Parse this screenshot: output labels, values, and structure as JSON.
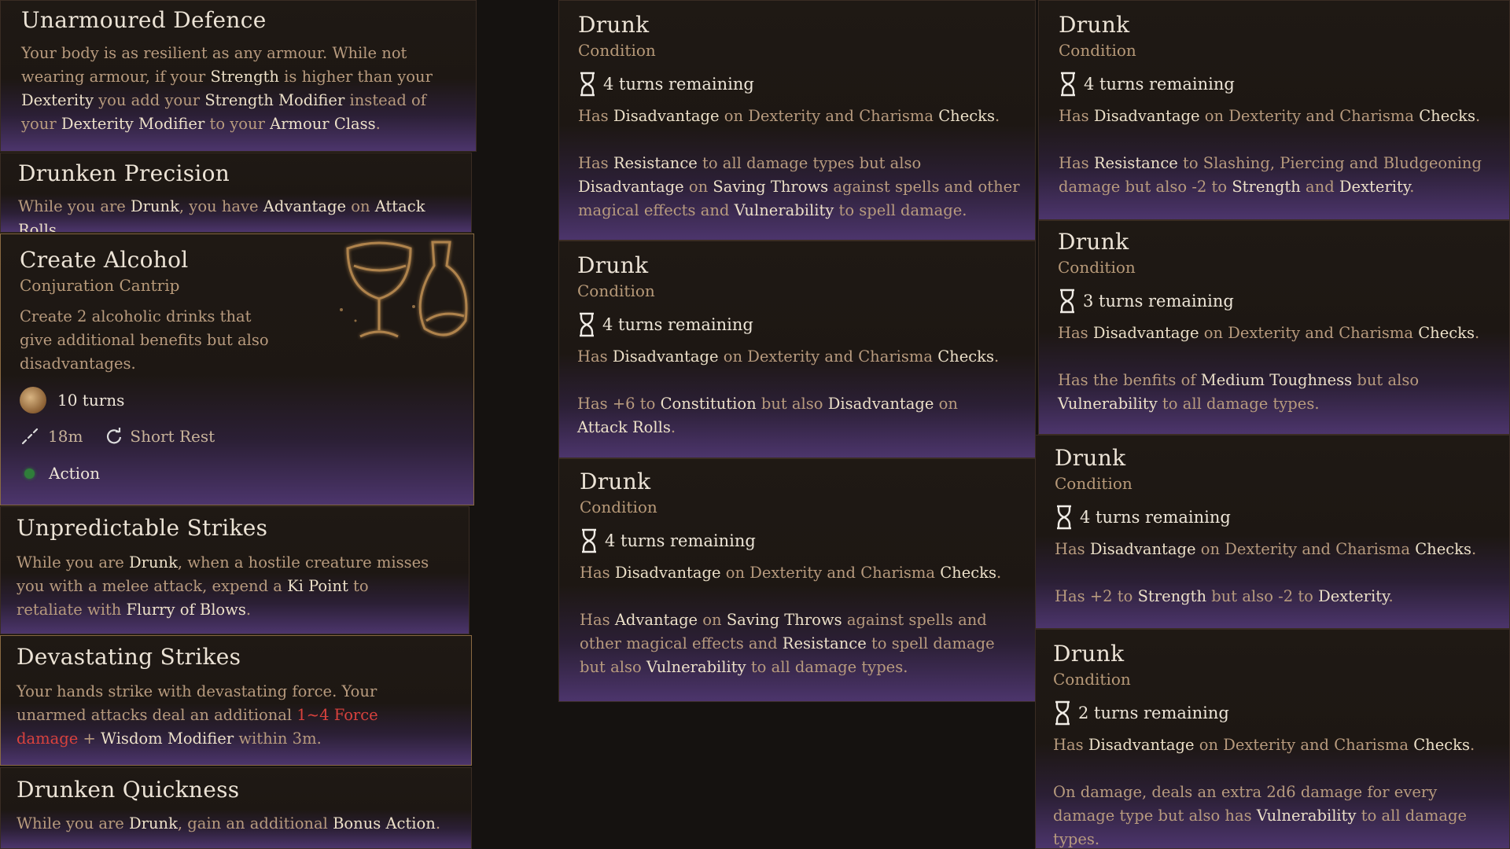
{
  "colors": {
    "accent_purple": "#4c356c",
    "highlight": "#ece0c8",
    "body_text": "#b89b7e",
    "damage_red": "#d9423d",
    "action_dot": "#2f7d3a"
  },
  "left": {
    "unarmoured": {
      "title": "Unarmoured Defence",
      "desc": [
        [
          "Your body is as resilient as any armour. While not wearing armour, if your ",
          0
        ],
        [
          "Strength",
          1
        ],
        [
          " is higher than your ",
          0
        ],
        [
          "Dexterity",
          1
        ],
        [
          " you add your ",
          0
        ],
        [
          "Strength Modifier",
          1
        ],
        [
          " instead of your ",
          0
        ],
        [
          "Dexterity Modifier",
          1
        ],
        [
          " to your ",
          0
        ],
        [
          "Armour Class",
          1
        ],
        [
          ".",
          0
        ]
      ]
    },
    "precision": {
      "title": "Drunken Precision",
      "desc": [
        [
          "While you are ",
          0
        ],
        [
          "Drunk",
          1
        ],
        [
          ", you have ",
          0
        ],
        [
          "Advantage",
          1
        ],
        [
          " on ",
          0
        ],
        [
          "Attack Rolls",
          1
        ],
        [
          ".",
          0
        ]
      ]
    },
    "alcohol": {
      "title": "Create Alcohol",
      "subtitle": "Conjuration Cantrip",
      "desc": [
        [
          "Create 2 alcoholic drinks that give additional benefits but also disadvantages.",
          0
        ]
      ],
      "duration": "10 turns",
      "range": "18m",
      "recharge": "Short Rest",
      "cost": "Action",
      "icons": {
        "duration": "potion-icon",
        "range": "range-icon",
        "recharge": "refresh-icon",
        "cost": "action-dot-icon",
        "art": "goblet-flask-icon"
      }
    },
    "unpredictable": {
      "title": "Unpredictable Strikes",
      "desc": [
        [
          "While you are ",
          0
        ],
        [
          "Drunk",
          1
        ],
        [
          ", when a hostile creature misses you with a melee attack, expend a ",
          0
        ],
        [
          "Ki Point",
          1
        ],
        [
          " to retaliate with ",
          0
        ],
        [
          "Flurry of Blows",
          1
        ],
        [
          ".",
          0
        ]
      ]
    },
    "devastating": {
      "title": "Devastating Strikes",
      "desc": [
        [
          "Your hands strike with devastating force. Your unarmed attacks deal an additional ",
          0
        ],
        [
          "1~4 Force damage",
          2
        ],
        [
          " + ",
          0
        ],
        [
          "Wisdom Modifier",
          1
        ],
        [
          " within 3m.",
          0
        ]
      ]
    },
    "quickness": {
      "title": "Drunken Quickness",
      "desc": [
        [
          "While you are ",
          0
        ],
        [
          "Drunk",
          1
        ],
        [
          ", gain an additional ",
          0
        ],
        [
          "Bonus Action",
          1
        ],
        [
          ".",
          0
        ]
      ]
    }
  },
  "conditions": [
    {
      "title": "Drunk",
      "subtitle": "Condition",
      "turns": "4 turns remaining",
      "paras": [
        [
          [
            "Has ",
            0
          ],
          [
            "Disadvantage",
            1
          ],
          [
            " on Dexterity and Charisma ",
            0
          ],
          [
            "Checks",
            1
          ],
          [
            ".",
            0
          ]
        ],
        [
          [
            "Has ",
            0
          ],
          [
            "Resistance",
            1
          ],
          [
            " to all damage types but also ",
            0
          ],
          [
            "Disadvantage",
            1
          ],
          [
            " on ",
            0
          ],
          [
            "Saving Throws",
            1
          ],
          [
            " against spells and other magical effects and ",
            0
          ],
          [
            "Vulnerability",
            1
          ],
          [
            " to spell damage.",
            0
          ]
        ]
      ]
    },
    {
      "title": "Drunk",
      "subtitle": "Condition",
      "turns": "4 turns remaining",
      "paras": [
        [
          [
            "Has ",
            0
          ],
          [
            "Disadvantage",
            1
          ],
          [
            " on Dexterity and Charisma ",
            0
          ],
          [
            "Checks",
            1
          ],
          [
            ".",
            0
          ]
        ],
        [
          [
            "Has +6 to ",
            0
          ],
          [
            "Constitution",
            1
          ],
          [
            " but also ",
            0
          ],
          [
            "Disadvantage",
            1
          ],
          [
            " on ",
            0
          ],
          [
            "Attack Rolls",
            1
          ],
          [
            ".",
            0
          ]
        ]
      ]
    },
    {
      "title": "Drunk",
      "subtitle": "Condition",
      "turns": "4 turns remaining",
      "paras": [
        [
          [
            "Has ",
            0
          ],
          [
            "Disadvantage",
            1
          ],
          [
            " on Dexterity and Charisma ",
            0
          ],
          [
            "Checks",
            1
          ],
          [
            ".",
            0
          ]
        ],
        [
          [
            "Has ",
            0
          ],
          [
            "Advantage",
            1
          ],
          [
            " on ",
            0
          ],
          [
            "Saving Throws",
            1
          ],
          [
            " against spells and other magical effects and ",
            0
          ],
          [
            "Resistance",
            1
          ],
          [
            " to spell damage but also ",
            0
          ],
          [
            "Vulnerability",
            1
          ],
          [
            " to all damage types.",
            0
          ]
        ]
      ]
    },
    {
      "title": "Drunk",
      "subtitle": "Condition",
      "turns": "4 turns remaining",
      "paras": [
        [
          [
            "Has ",
            0
          ],
          [
            "Disadvantage",
            1
          ],
          [
            " on Dexterity and Charisma ",
            0
          ],
          [
            "Checks",
            1
          ],
          [
            ".",
            0
          ]
        ],
        [
          [
            "Has ",
            0
          ],
          [
            "Resistance",
            1
          ],
          [
            " to Slashing, Piercing and Bludgeoning damage but also -2 to ",
            0
          ],
          [
            "Strength",
            1
          ],
          [
            " and ",
            0
          ],
          [
            "Dexterity",
            1
          ],
          [
            ".",
            0
          ]
        ]
      ]
    },
    {
      "title": "Drunk",
      "subtitle": "Condition",
      "turns": "3 turns remaining",
      "paras": [
        [
          [
            "Has ",
            0
          ],
          [
            "Disadvantage",
            1
          ],
          [
            " on Dexterity and Charisma ",
            0
          ],
          [
            "Checks",
            1
          ],
          [
            ".",
            0
          ]
        ],
        [
          [
            "Has the benfits of ",
            0
          ],
          [
            "Medium Toughness",
            1
          ],
          [
            " but also ",
            0
          ],
          [
            "Vulnerability",
            1
          ],
          [
            " to all damage types.",
            0
          ]
        ]
      ]
    },
    {
      "title": "Drunk",
      "subtitle": "Condition",
      "turns": "4 turns remaining",
      "paras": [
        [
          [
            "Has ",
            0
          ],
          [
            "Disadvantage",
            1
          ],
          [
            " on Dexterity and Charisma ",
            0
          ],
          [
            "Checks",
            1
          ],
          [
            ".",
            0
          ]
        ],
        [
          [
            "Has +2 to ",
            0
          ],
          [
            "Strength",
            1
          ],
          [
            " but also -2 to ",
            0
          ],
          [
            "Dexterity",
            1
          ],
          [
            ".",
            0
          ]
        ]
      ]
    },
    {
      "title": "Drunk",
      "subtitle": "Condition",
      "turns": "2 turns remaining",
      "paras": [
        [
          [
            "Has ",
            0
          ],
          [
            "Disadvantage",
            1
          ],
          [
            " on Dexterity and Charisma ",
            0
          ],
          [
            "Checks",
            1
          ],
          [
            ".",
            0
          ]
        ],
        [
          [
            "On damage, deals an extra 2d6 damage for every damage type but also has ",
            0
          ],
          [
            "Vulnerability",
            1
          ],
          [
            " to all damage types.",
            0
          ]
        ]
      ]
    }
  ]
}
